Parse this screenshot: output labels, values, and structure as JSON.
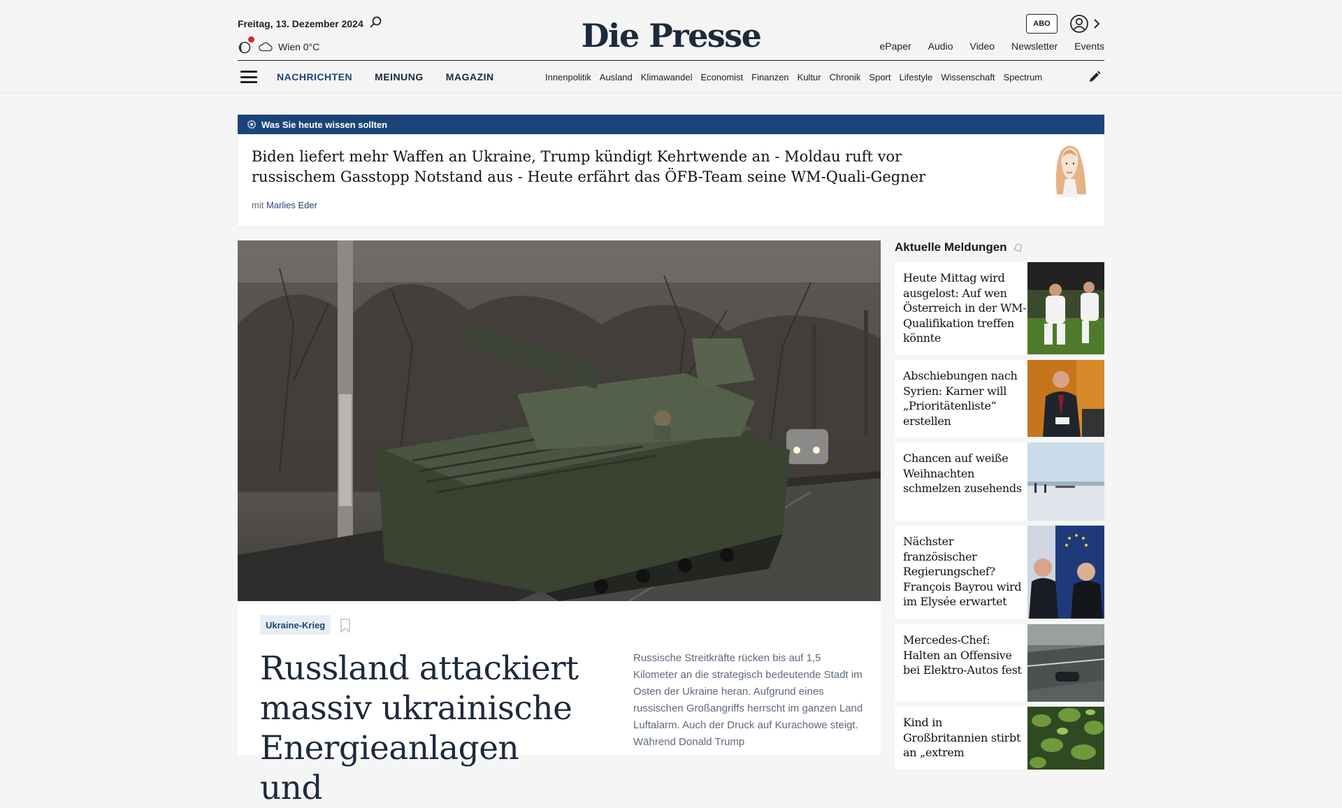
{
  "header": {
    "date": "Freitag, 13. Dezember 2024",
    "weather": "Wien 0°C",
    "logo": "Die Presse",
    "abo_label": "ABO",
    "top_links": [
      "ePaper",
      "Audio",
      "Video",
      "Newsletter",
      "Events"
    ]
  },
  "nav": {
    "main": [
      "NACHRICHTEN",
      "MEINUNG",
      "MAGAZIN"
    ],
    "sections": [
      "Innenpolitik",
      "Ausland",
      "Klimawandel",
      "Economist",
      "Finanzen",
      "Kultur",
      "Chronik",
      "Sport",
      "Lifestyle",
      "Wissenschaft",
      "Spectrum"
    ]
  },
  "briefing": {
    "label": "Was Sie heute wissen sollten",
    "headline": "Biden liefert mehr Waffen an Ukraine, Trump kündigt Kehrtwende an - Moldau ruft vor russischem Gasstopp Notstand aus - Heute erfährt das ÖFB-Team seine WM-Quali-Gegner",
    "author_prefix": "mit",
    "author": "Marlies Eder"
  },
  "article": {
    "tag": "Ukraine-Krieg",
    "title": "Russland attackiert massiv ukrainische Energieanlagen und",
    "lead": "Russische Streitkräfte rücken bis auf 1,5 Kilometer an die strategisch bedeutende Stadt im Osten der Ukraine heran. Aufgrund eines russischen Großangriffs herrscht im ganzen Land Luftalarm. Auch der Druck auf Kurachowe steigt. Während Donald Trump"
  },
  "sidebar": {
    "title": "Aktuelle Meldungen",
    "items": [
      {
        "title": "Heute Mittag wird ausgelost: Auf wen Österreich in der WM-Qualifikation treffen könnte"
      },
      {
        "title": "Abschiebungen nach Syrien: Karner will „Prioritätenliste“ erstellen"
      },
      {
        "title": "Chancen auf weiße Weihnachten schmelzen zusehends"
      },
      {
        "title": "Nächster französischer Regierungschef? François Bayrou wird im Elysée erwartet"
      },
      {
        "title": "Mercedes-Chef: Halten an Offensive bei Elektro-Autos fest"
      },
      {
        "title": "Kind in Großbritannien stirbt an „extrem"
      }
    ]
  },
  "colors": {
    "brand_blue": "#1d4478",
    "logo": "#1c2a3c",
    "alert_red": "#d9272e"
  }
}
